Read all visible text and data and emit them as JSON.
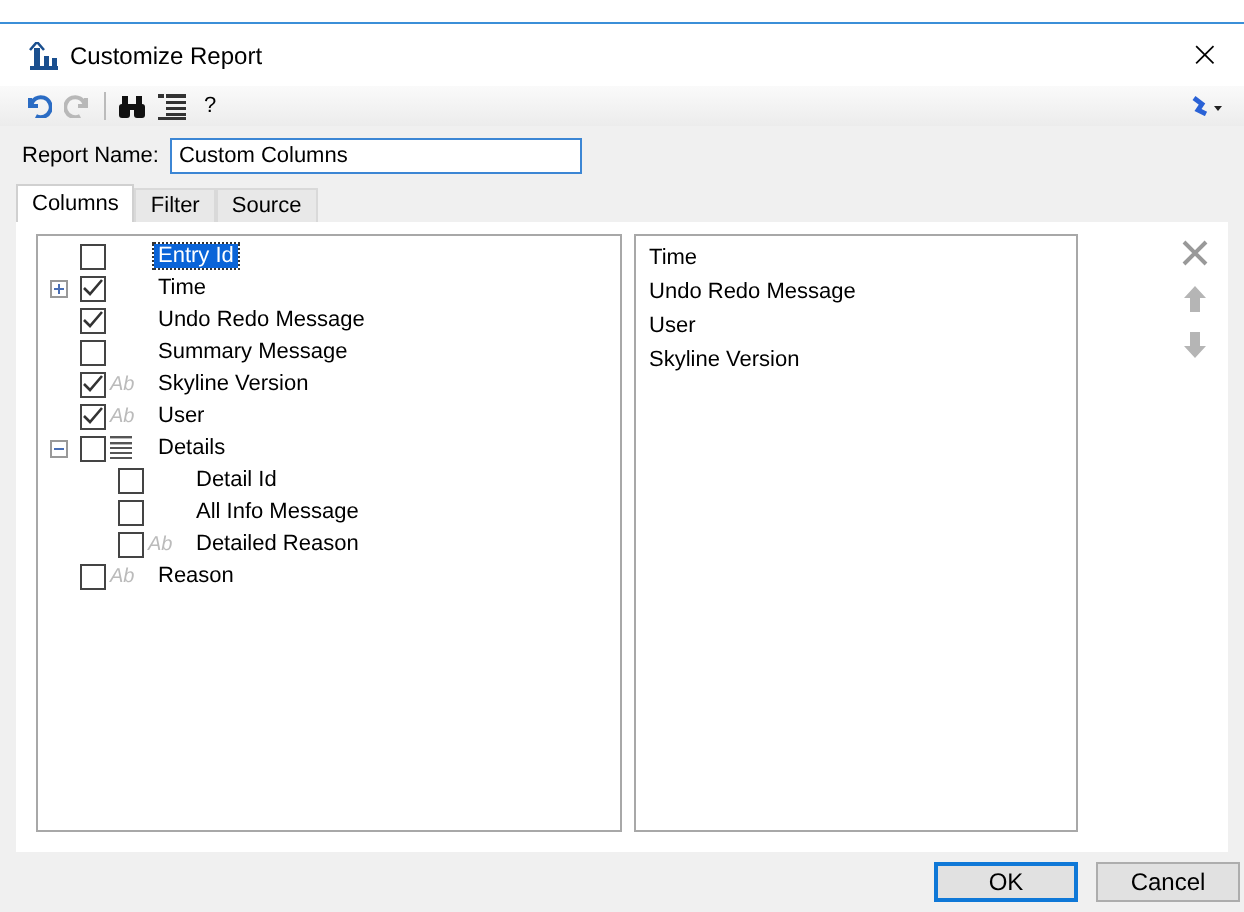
{
  "window": {
    "title": "Customize Report",
    "close": "×"
  },
  "toolbar": {
    "help": "?"
  },
  "report_name": {
    "label": "Report Name:",
    "value": "Custom Columns"
  },
  "tabs": [
    {
      "label": "Columns",
      "selected": true
    },
    {
      "label": "Filter",
      "selected": false
    },
    {
      "label": "Source",
      "selected": false
    }
  ],
  "tree": [
    {
      "label": "Entry Id",
      "checked": false,
      "selected": true
    },
    {
      "label": "Time",
      "checked": true,
      "selected": false,
      "expanded": false
    },
    {
      "label": "Undo Redo Message",
      "checked": true,
      "selected": false
    },
    {
      "label": "Summary Message",
      "checked": false,
      "selected": false
    },
    {
      "label": "Skyline Version",
      "checked": true,
      "selected": false,
      "glyph": "Ab"
    },
    {
      "label": "User",
      "checked": true,
      "selected": false,
      "glyph": "Ab"
    },
    {
      "label": "Details",
      "checked": false,
      "selected": false,
      "expanded": true,
      "kind": "list",
      "children": [
        {
          "label": "Detail Id",
          "checked": false,
          "selected": false
        },
        {
          "label": "All Info Message",
          "checked": false,
          "selected": false
        },
        {
          "label": "Detailed Reason",
          "checked": false,
          "selected": false,
          "glyph": "Ab"
        }
      ]
    },
    {
      "label": "Reason",
      "checked": false,
      "selected": false,
      "glyph": "Ab"
    }
  ],
  "selected_columns": [
    "Time",
    "Undo Redo Message",
    "User",
    "Skyline Version"
  ],
  "buttons": [
    "OK",
    "Cancel"
  ]
}
